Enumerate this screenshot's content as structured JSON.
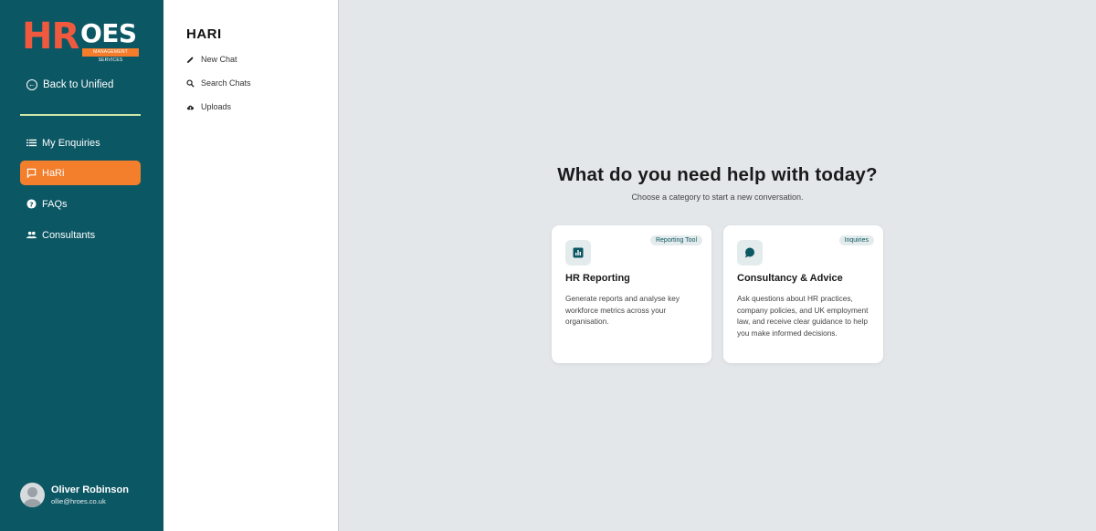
{
  "brand": {
    "logo_main": "HR",
    "logo_secondary": "OES",
    "logo_tagline": "MANAGEMENT SERVICES"
  },
  "sidebar": {
    "back_label": "Back to Unified",
    "items": [
      {
        "label": "My Enquiries",
        "icon": "list-icon",
        "active": false
      },
      {
        "label": "HaRi",
        "icon": "chat-icon",
        "active": true
      },
      {
        "label": "FAQs",
        "icon": "help-icon",
        "active": false
      },
      {
        "label": "Consultants",
        "icon": "people-icon",
        "active": false
      }
    ],
    "user": {
      "name": "Oliver Robinson",
      "email": "ollie@hroes.co.uk"
    }
  },
  "panel": {
    "title": "HARI",
    "items": [
      {
        "label": "New Chat",
        "icon": "pencil-icon"
      },
      {
        "label": "Search Chats",
        "icon": "search-icon"
      },
      {
        "label": "Uploads",
        "icon": "cloud-upload-icon"
      }
    ]
  },
  "main": {
    "heading": "What do you need help with today?",
    "subheading": "Choose a category to start a new conversation.",
    "cards": [
      {
        "badge": "Reporting Tool",
        "title": "HR Reporting",
        "description": "Generate reports and analyse key workforce metrics across your organisation.",
        "icon": "bar-chart-icon"
      },
      {
        "badge": "Inquiries",
        "title": "Consultancy & Advice",
        "description": "Ask questions about HR practices, company policies, and UK employment law, and receive clear guidance to help you make informed decisions.",
        "icon": "speech-bubble-icon"
      }
    ]
  },
  "colors": {
    "sidebar": "#0c5764",
    "accent": "#f37e2c",
    "logo_red": "#ef5a3f",
    "background": "#e3e7ea"
  }
}
